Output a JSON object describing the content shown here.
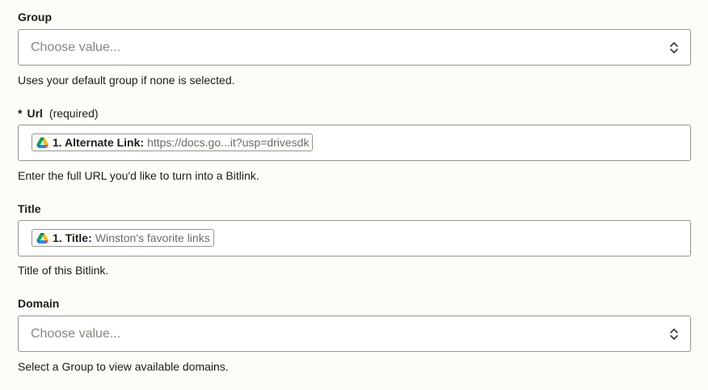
{
  "group": {
    "label": "Group",
    "placeholder": "Choose value...",
    "help": "Uses your default group if none is selected."
  },
  "url": {
    "required_star": "*",
    "label": "Url",
    "required_note": "(required)",
    "pill_key": "1. Alternate Link:",
    "pill_value": "https://docs.go...it?usp=drivesdk",
    "pill_icon": "google-drive-icon",
    "help": "Enter the full URL you'd like to turn into a Bitlink."
  },
  "title": {
    "label": "Title",
    "pill_key": "1. Title:",
    "pill_value": "Winston's favorite links",
    "pill_icon": "google-drive-icon",
    "help": "Title of this Bitlink."
  },
  "domain": {
    "label": "Domain",
    "placeholder": "Choose value...",
    "help": "Select a Group to view available domains."
  },
  "colors": {
    "background": "#fdfcf9",
    "border": "#9a958b",
    "placeholder": "#8a8680"
  }
}
